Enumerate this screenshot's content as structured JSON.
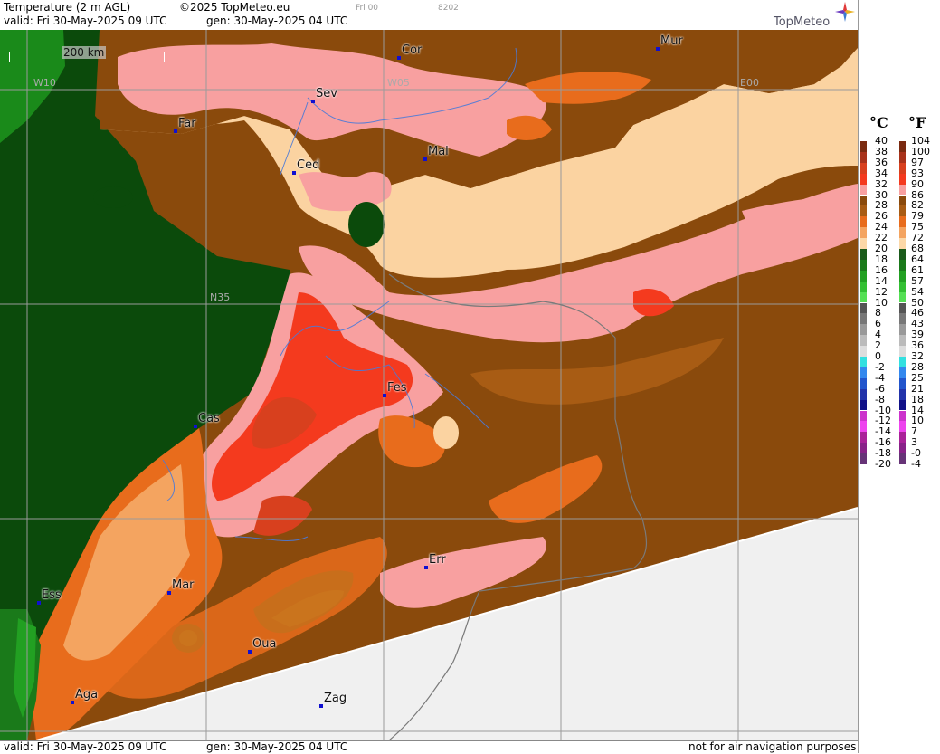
{
  "header": {
    "title": "Temperature (2 m AGL)",
    "copyright": "©2025 TopMeteo.eu",
    "run_label": "Fri 00",
    "code": "8202",
    "valid": "valid:  Fri  30-May-2025  09 UTC",
    "gen": "gen: 30-May-2025 04 UTC",
    "brand": "TopMeteo"
  },
  "footer": {
    "valid": "valid:  Fri  30-May-2025  09 UTC",
    "gen": "gen: 30-May-2025 04 UTC",
    "note": "not for air navigation purposes"
  },
  "scale": "200 km",
  "grid_labels": [
    "W10",
    "W05",
    "E00",
    "N35"
  ],
  "cities": [
    {
      "name": "Cor"
    },
    {
      "name": "Mur"
    },
    {
      "name": "Sev"
    },
    {
      "name": "Far"
    },
    {
      "name": "Mal"
    },
    {
      "name": "Ced"
    },
    {
      "name": "Fes"
    },
    {
      "name": "Cas"
    },
    {
      "name": "Err"
    },
    {
      "name": "Mar"
    },
    {
      "name": "Ess"
    },
    {
      "name": "Oua"
    },
    {
      "name": "Aga"
    },
    {
      "name": "Zag"
    }
  ],
  "legend": {
    "unit_c": "°C",
    "unit_f": "°F",
    "celsius": [
      "40",
      "38",
      "36",
      "34",
      "32",
      "30",
      "28",
      "26",
      "24",
      "22",
      "20",
      "18",
      "16",
      "14",
      "12",
      "10",
      "8",
      "6",
      "4",
      "2",
      "0",
      "-2",
      "-4",
      "-6",
      "-8",
      "-10",
      "-12",
      "-14",
      "-16",
      "-18",
      "-20"
    ],
    "fahrenheit": [
      "104",
      "100",
      "97",
      "93",
      "90",
      "86",
      "82",
      "79",
      "75",
      "72",
      "68",
      "64",
      "61",
      "57",
      "54",
      "50",
      "46",
      "43",
      "39",
      "36",
      "32",
      "28",
      "25",
      "21",
      "18",
      "14",
      "10",
      "7",
      "3",
      "-0",
      "-4"
    ],
    "colors": [
      "#7a2a10",
      "#a8321a",
      "#d8401e",
      "#f43a1e",
      "#f8a0a0",
      "#8a4a0c",
      "#a85c14",
      "#e86c1c",
      "#f4a460",
      "#fcd8a8",
      "#1a5a1a",
      "#1a7a1a",
      "#22a022",
      "#33c033",
      "#55e055",
      "#555555",
      "#777777",
      "#999999",
      "#bbbbbb",
      "#dddddd",
      "#33e0e0",
      "#3388ee",
      "#2255cc",
      "#2233aa",
      "#111188",
      "#cc33cc",
      "#ee44ee",
      "#aa2299",
      "#882288",
      "#663377"
    ]
  }
}
